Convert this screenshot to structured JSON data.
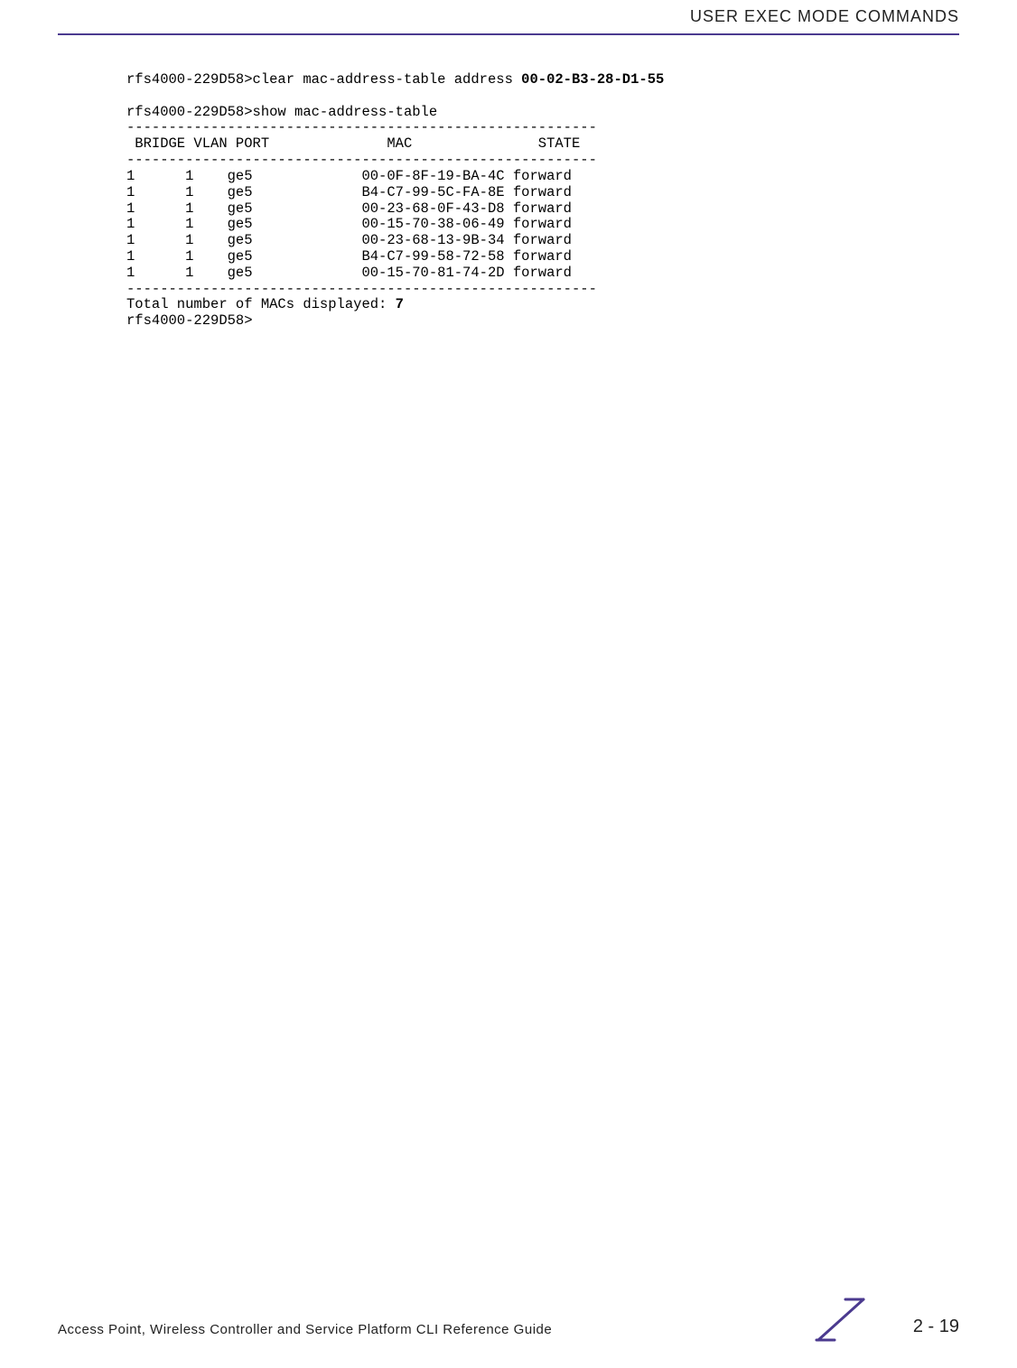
{
  "header": {
    "title": "USER EXEC MODE COMMANDS"
  },
  "terminal": {
    "lines": [
      {
        "text": "rfs4000-229D58>clear mac-address-table address ",
        "bold_tail": "00-02-B3-28-D1-55"
      },
      {
        "text": ""
      },
      {
        "text": "rfs4000-229D58>show mac-address-table"
      },
      {
        "text": "--------------------------------------------------------"
      },
      {
        "text": " BRIDGE VLAN PORT              MAC               STATE"
      },
      {
        "text": "--------------------------------------------------------"
      },
      {
        "text": "1      1    ge5             00-0F-8F-19-BA-4C forward"
      },
      {
        "text": "1      1    ge5             B4-C7-99-5C-FA-8E forward"
      },
      {
        "text": "1      1    ge5             00-23-68-0F-43-D8 forward"
      },
      {
        "text": "1      1    ge5             00-15-70-38-06-49 forward"
      },
      {
        "text": "1      1    ge5             00-23-68-13-9B-34 forward"
      },
      {
        "text": "1      1    ge5             B4-C7-99-58-72-58 forward"
      },
      {
        "text": "1      1    ge5             00-15-70-81-74-2D forward"
      },
      {
        "text": "--------------------------------------------------------"
      },
      {
        "text": "Total number of MACs displayed: ",
        "bold_tail": "7"
      },
      {
        "text": "rfs4000-229D58>"
      }
    ]
  },
  "footer": {
    "text": "Access Point, Wireless Controller and Service Platform CLI Reference Guide",
    "page_number": "2 - 19"
  }
}
